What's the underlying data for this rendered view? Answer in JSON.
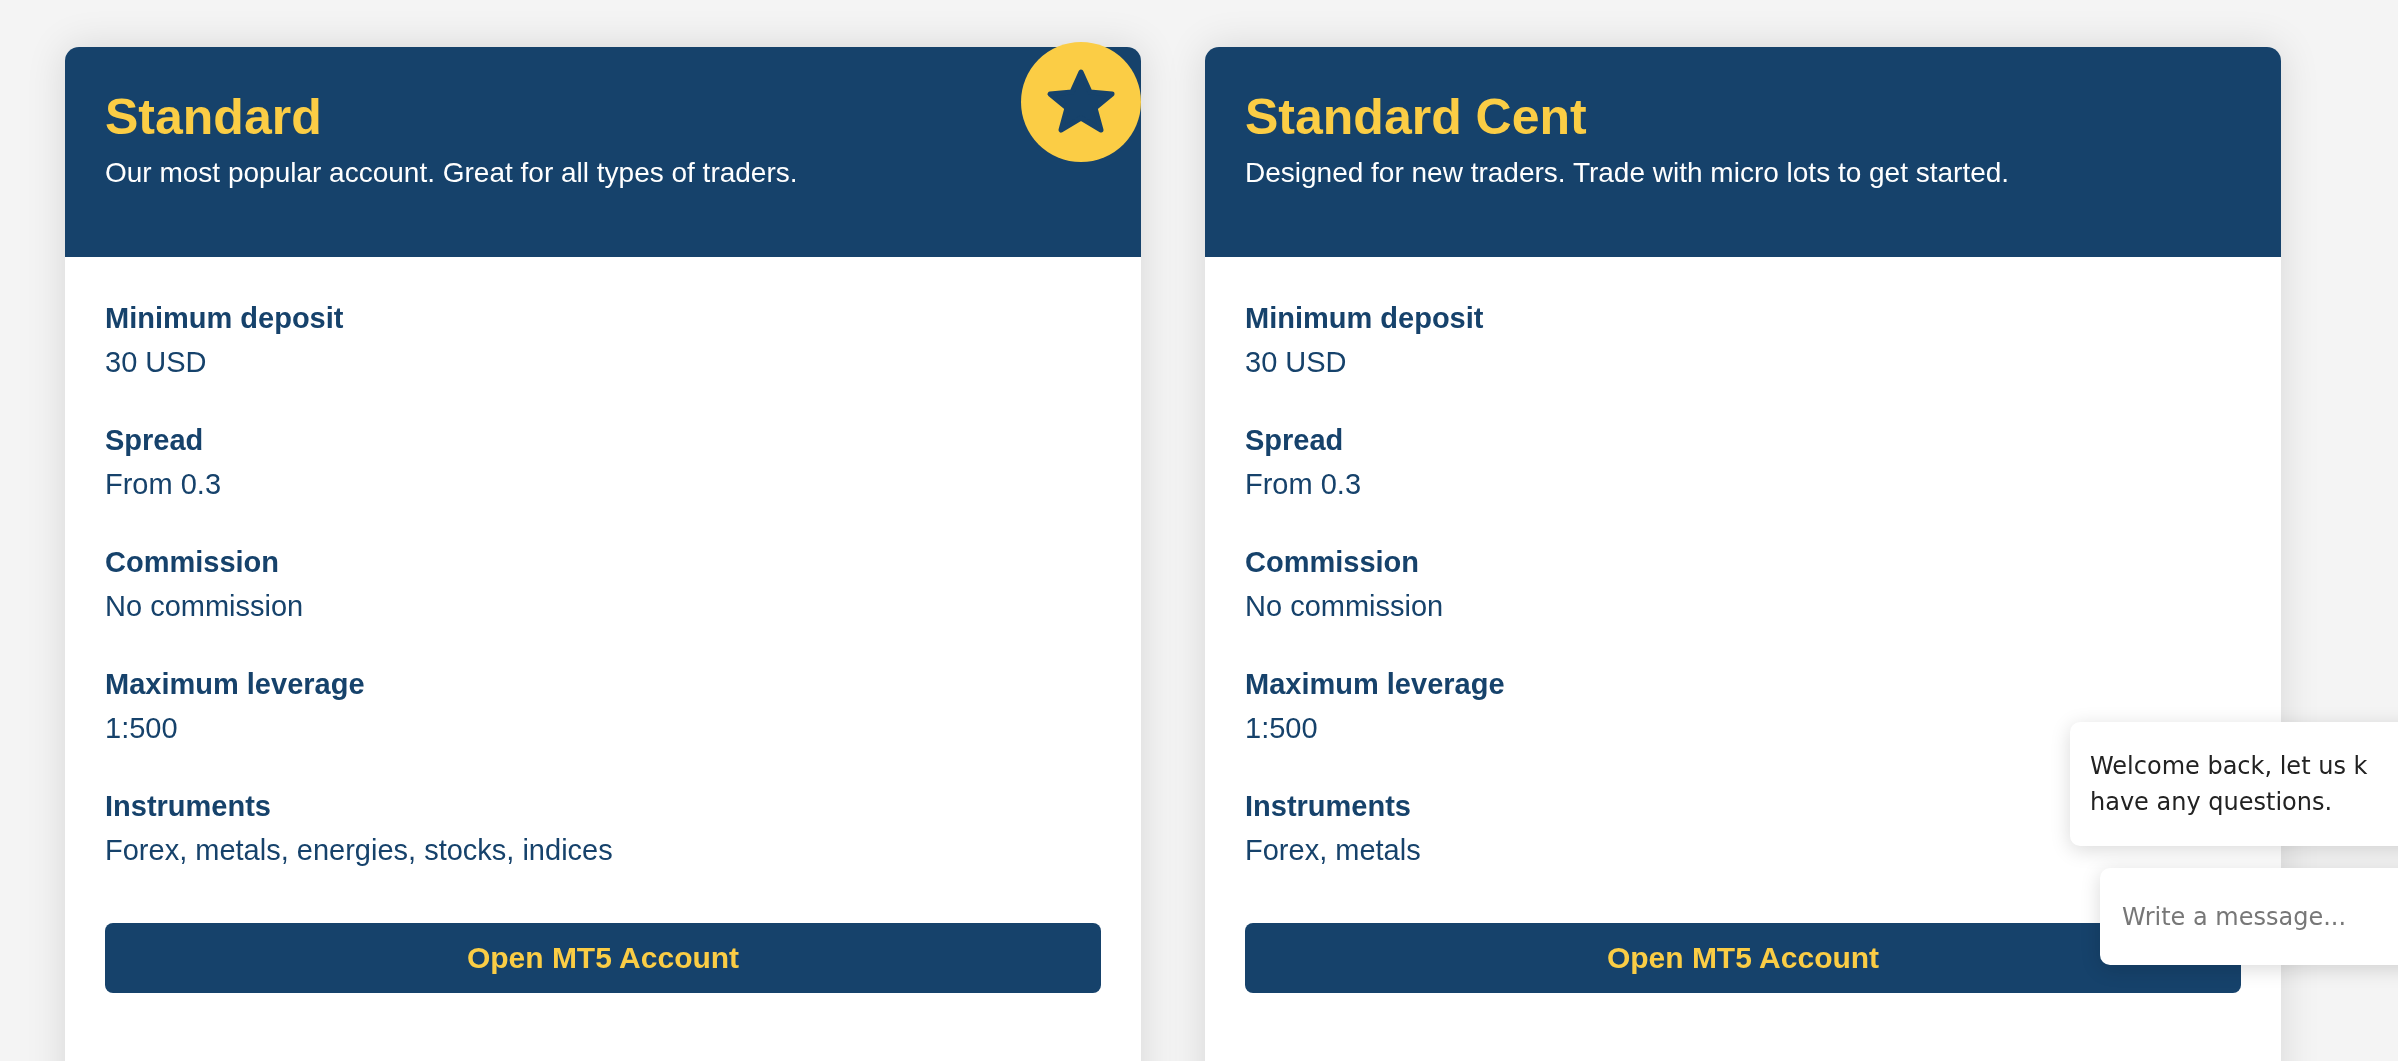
{
  "cards": [
    {
      "title": "Standard",
      "subtitle": "Our most popular account. Great for all types of traders.",
      "featured": true,
      "specs": [
        {
          "label": "Minimum deposit",
          "value": "30 USD"
        },
        {
          "label": "Spread",
          "value": "From 0.3"
        },
        {
          "label": "Commission",
          "value": "No commission"
        },
        {
          "label": "Maximum leverage",
          "value": "1:500"
        },
        {
          "label": "Instruments",
          "value": "Forex, metals, energies, stocks, indices"
        }
      ],
      "button": "Open MT5 Account"
    },
    {
      "title": "Standard Cent",
      "subtitle": "Designed for new traders. Trade with micro lots to get started.",
      "featured": false,
      "specs": [
        {
          "label": "Minimum deposit",
          "value": "30 USD"
        },
        {
          "label": "Spread",
          "value": "From 0.3"
        },
        {
          "label": "Commission",
          "value": "No commission"
        },
        {
          "label": "Maximum leverage",
          "value": "1:500"
        },
        {
          "label": "Instruments",
          "value": "Forex, metals"
        }
      ],
      "button": "Open MT5 Account"
    }
  ],
  "chat": {
    "message_lines": [
      "Welcome back, let us k",
      "have any questions."
    ],
    "input": {
      "placeholder": "Write a message..."
    }
  }
}
